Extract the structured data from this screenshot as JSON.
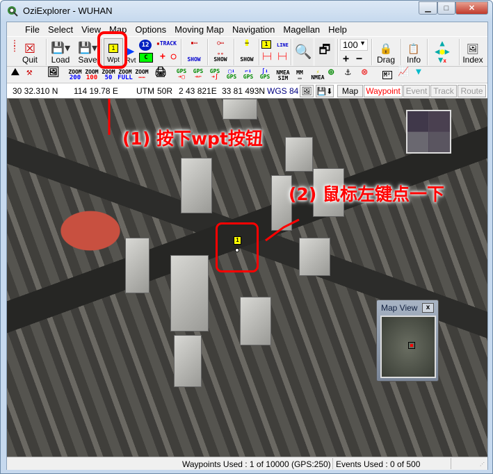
{
  "window": {
    "title": "OziExplorer - WUHAN",
    "minimize": "▁",
    "maximize": "□",
    "close": "✕"
  },
  "menu": [
    "File",
    "Select",
    "View",
    "Map",
    "Options",
    "Moving Map",
    "Navigation",
    "Magellan",
    "Help"
  ],
  "toolbar1": {
    "quit": "Quit",
    "load": "Load",
    "save": "Save",
    "wpt": "Wpt",
    "wpt_icon": "1",
    "rvt": "Rvt",
    "num12": "12",
    "c": "C",
    "track": "TRACK",
    "show": "SHOW",
    "line": "LINE",
    "zoom_value": "100",
    "drag": "Drag",
    "info": "Info",
    "index": "Index"
  },
  "toolbar2": {
    "zoom": "ZOOM",
    "z200": "200",
    "z100": "100",
    "z50": "50",
    "zfull": "FULL",
    "gps": "GPS",
    "nmea": "NMEA",
    "sim": "SIM",
    "mm": "MM",
    "m2": "M²"
  },
  "coords": {
    "lat": "30 32.310 N",
    "lon": "114 19.78  E",
    "utm": "UTM",
    "zone": "50R",
    "easting": "2 43 821E",
    "northing": "33 81 493N",
    "datum": "WGS 84"
  },
  "tabs": [
    {
      "label": "Map",
      "state": "normal"
    },
    {
      "label": "Waypoint",
      "state": "active"
    },
    {
      "label": "Event",
      "state": "disabled"
    },
    {
      "label": "Track",
      "state": "disabled"
    },
    {
      "label": "Route",
      "state": "disabled"
    }
  ],
  "map": {
    "waypoint_label": "1",
    "mapview_title": "Map View",
    "mapview_close": "x"
  },
  "annotations": {
    "step1": "(1) 按下wpt按钮",
    "step2": "(2) 鼠标左键点一下",
    "color": "#ff0000"
  },
  "status": {
    "waypoints": "Waypoints Used : 1 of 10000  (GPS:250)",
    "events": "Events Used : 0 of 500"
  },
  "colors": {
    "waypoint_tab": "#ff0000",
    "datum": "#000080",
    "zoom_text": "#0000ff"
  }
}
